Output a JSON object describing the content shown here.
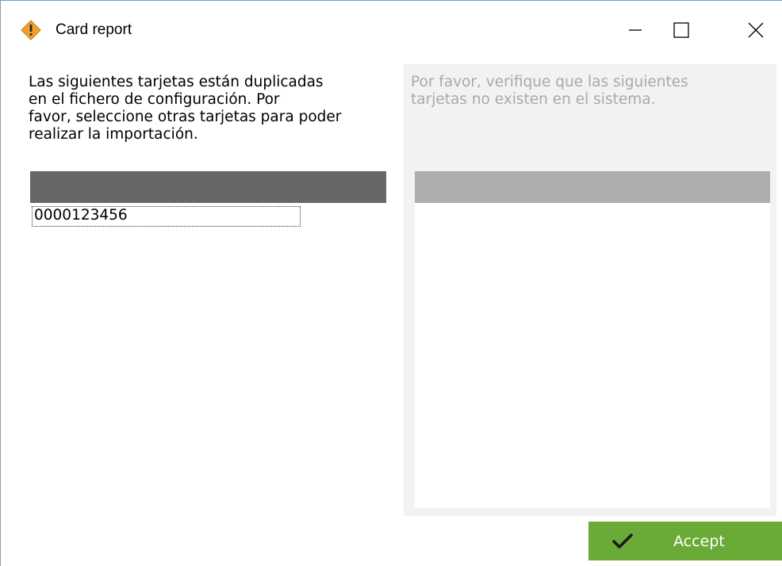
{
  "window": {
    "title": "Card report",
    "icon": "warning-diamond-icon",
    "controls": [
      "minimize-icon",
      "maximize-icon",
      "close-icon"
    ]
  },
  "left": {
    "message": "Las siguientes tarjetas están duplicadas\nen el fichero de configuración. Por\nfavor, seleccione otras tarjetas para poder\nrealizar la importación.",
    "cards": [
      "0000123456"
    ]
  },
  "right": {
    "message": "Por favor, verifique que las siguientes\ntarjetas no existen en el sistema.",
    "cards": []
  },
  "actions": {
    "accept_label": "Accept",
    "accept_icon": "checkmark-icon"
  },
  "colors": {
    "accent_green": "#6aab38",
    "left_header": "#676767",
    "right_header": "#adadad",
    "disabled_text": "#a9a9a9",
    "warning_orange": "#f0a030"
  }
}
